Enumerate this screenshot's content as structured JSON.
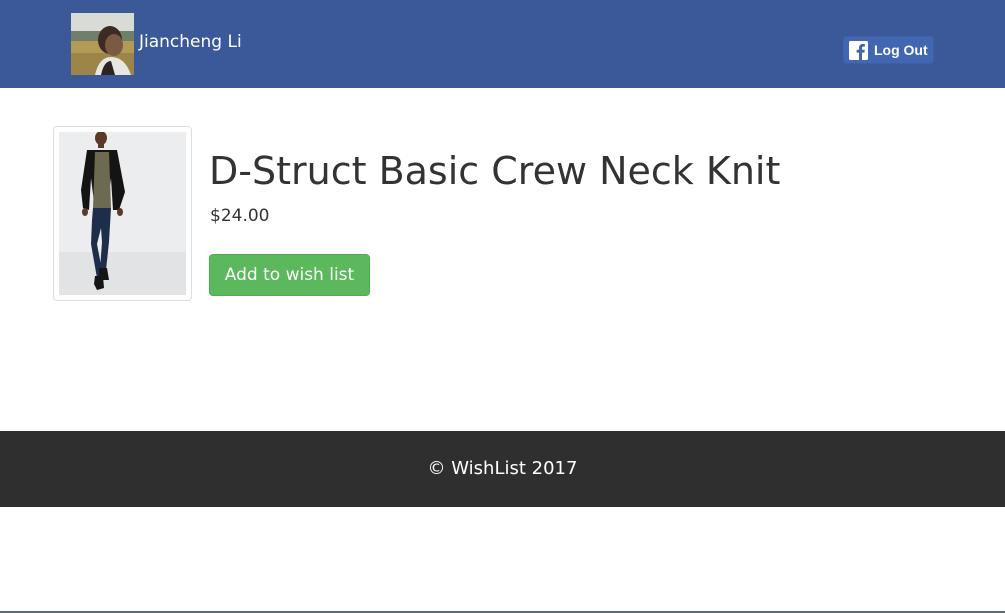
{
  "header": {
    "user_name": "Jiancheng Li",
    "logout_label": "Log Out",
    "background_color": "#3b5998",
    "logout_icon": "facebook-icon"
  },
  "product": {
    "title": "D-Struct Basic Crew Neck Knit",
    "price": "$24.00",
    "add_button_label": "Add to wish list",
    "button_color": "#5cb85c"
  },
  "footer": {
    "text": "© WishList 2017",
    "background_color": "#2f2f2f"
  }
}
